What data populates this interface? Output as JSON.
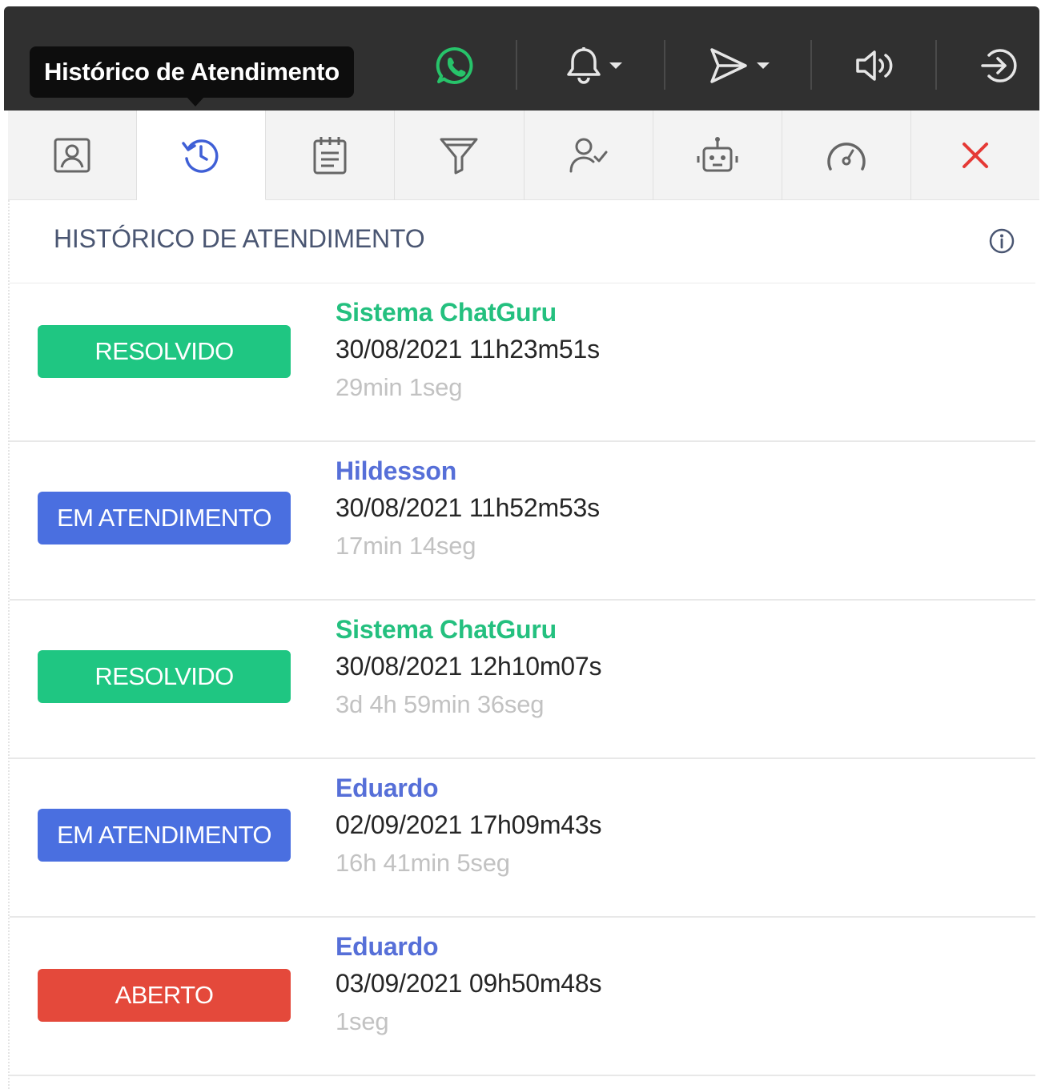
{
  "topbar": {
    "tooltip": "Histórico de Atendimento",
    "icons": [
      "whatsapp-icon",
      "bell-icon",
      "send-icon",
      "speaker-icon",
      "logout-icon"
    ]
  },
  "tabs": [
    {
      "icon": "contact-card-icon",
      "active": false
    },
    {
      "icon": "history-icon",
      "active": true
    },
    {
      "icon": "notes-icon",
      "active": false
    },
    {
      "icon": "filter-icon",
      "active": false
    },
    {
      "icon": "user-check-icon",
      "active": false
    },
    {
      "icon": "robot-icon",
      "active": false
    },
    {
      "icon": "speedometer-icon",
      "active": false
    },
    {
      "icon": "close-icon",
      "active": false
    }
  ],
  "section": {
    "title": "HISTÓRICO DE ATENDIMENTO"
  },
  "history": [
    {
      "status": "RESOLVIDO",
      "agent": "Sistema ChatGuru",
      "datetime": "30/08/2021 11h23m51s",
      "duration": "29min 1seg"
    },
    {
      "status": "EM ATENDIMENTO",
      "agent": "Hildesson",
      "datetime": "30/08/2021 11h52m53s",
      "duration": "17min 14seg"
    },
    {
      "status": "RESOLVIDO",
      "agent": "Sistema ChatGuru",
      "datetime": "30/08/2021 12h10m07s",
      "duration": "3d 4h 59min 36seg"
    },
    {
      "status": "EM ATENDIMENTO",
      "agent": "Eduardo",
      "datetime": "02/09/2021 17h09m43s",
      "duration": "16h 41min 5seg"
    },
    {
      "status": "ABERTO",
      "agent": "Eduardo",
      "datetime": "03/09/2021 09h50m48s",
      "duration": "1seg"
    }
  ],
  "colors": {
    "resolvido": "#1fc682",
    "em_atendimento": "#4a6fe0",
    "aberto": "#e4493b",
    "active_tab": "#3f5fd6",
    "close": "#e53935"
  }
}
